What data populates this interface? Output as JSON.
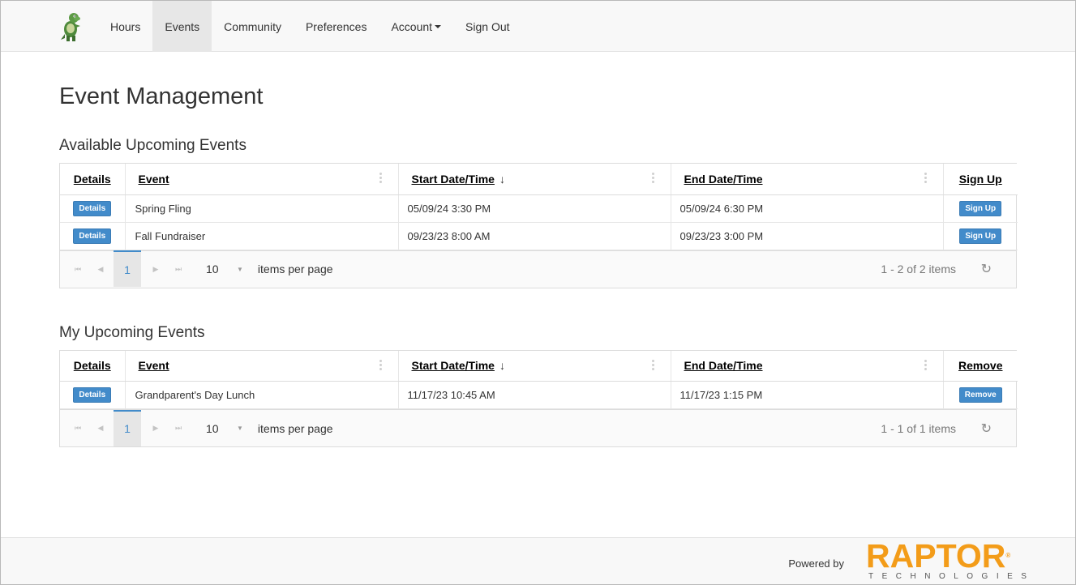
{
  "nav": {
    "items": [
      {
        "label": "Hours",
        "active": false
      },
      {
        "label": "Events",
        "active": true
      },
      {
        "label": "Community",
        "active": false
      },
      {
        "label": "Preferences",
        "active": false
      },
      {
        "label": "Account",
        "active": false
      },
      {
        "label": "Sign Out",
        "active": false
      }
    ],
    "account_caret": "chevron-down-icon"
  },
  "page": {
    "title": "Event Management"
  },
  "available": {
    "title": "Available Upcoming Events",
    "headers": {
      "details": "Details",
      "event": "Event",
      "start": "Start Date/Time",
      "start_sort": "↓",
      "end": "End Date/Time",
      "action": "Sign Up"
    },
    "rows": [
      {
        "details": "Details",
        "event": "Spring Fling",
        "start": "05/09/24 3:30 PM",
        "end": "05/09/24 6:30 PM",
        "action": "Sign Up"
      },
      {
        "details": "Details",
        "event": "Fall Fundraiser",
        "start": "09/23/23 8:00 AM",
        "end": "09/23/23 3:00 PM",
        "action": "Sign Up"
      }
    ],
    "pager": {
      "page": "1",
      "page_size": "10",
      "per_page_label": "items per page",
      "info": "1 - 2 of 2 items"
    }
  },
  "mine": {
    "title": "My Upcoming Events",
    "headers": {
      "details": "Details",
      "event": "Event",
      "start": "Start Date/Time",
      "start_sort": "↓",
      "end": "End Date/Time",
      "action": "Remove"
    },
    "rows": [
      {
        "details": "Details",
        "event": "Grandparent's Day Lunch",
        "start": "11/17/23 10:45 AM",
        "end": "11/17/23 1:15 PM",
        "action": "Remove"
      }
    ],
    "pager": {
      "page": "1",
      "page_size": "10",
      "per_page_label": "items per page",
      "info": "1 - 1 of 1 items"
    }
  },
  "footer": {
    "powered_by": "Powered by",
    "brand": "RAPTOR",
    "brand_sub": "TECHNOLOGIES",
    "brand_color": "#f39c19"
  },
  "colors": {
    "accent": "#428bca",
    "nav_active_bg": "#e7e7e7"
  }
}
